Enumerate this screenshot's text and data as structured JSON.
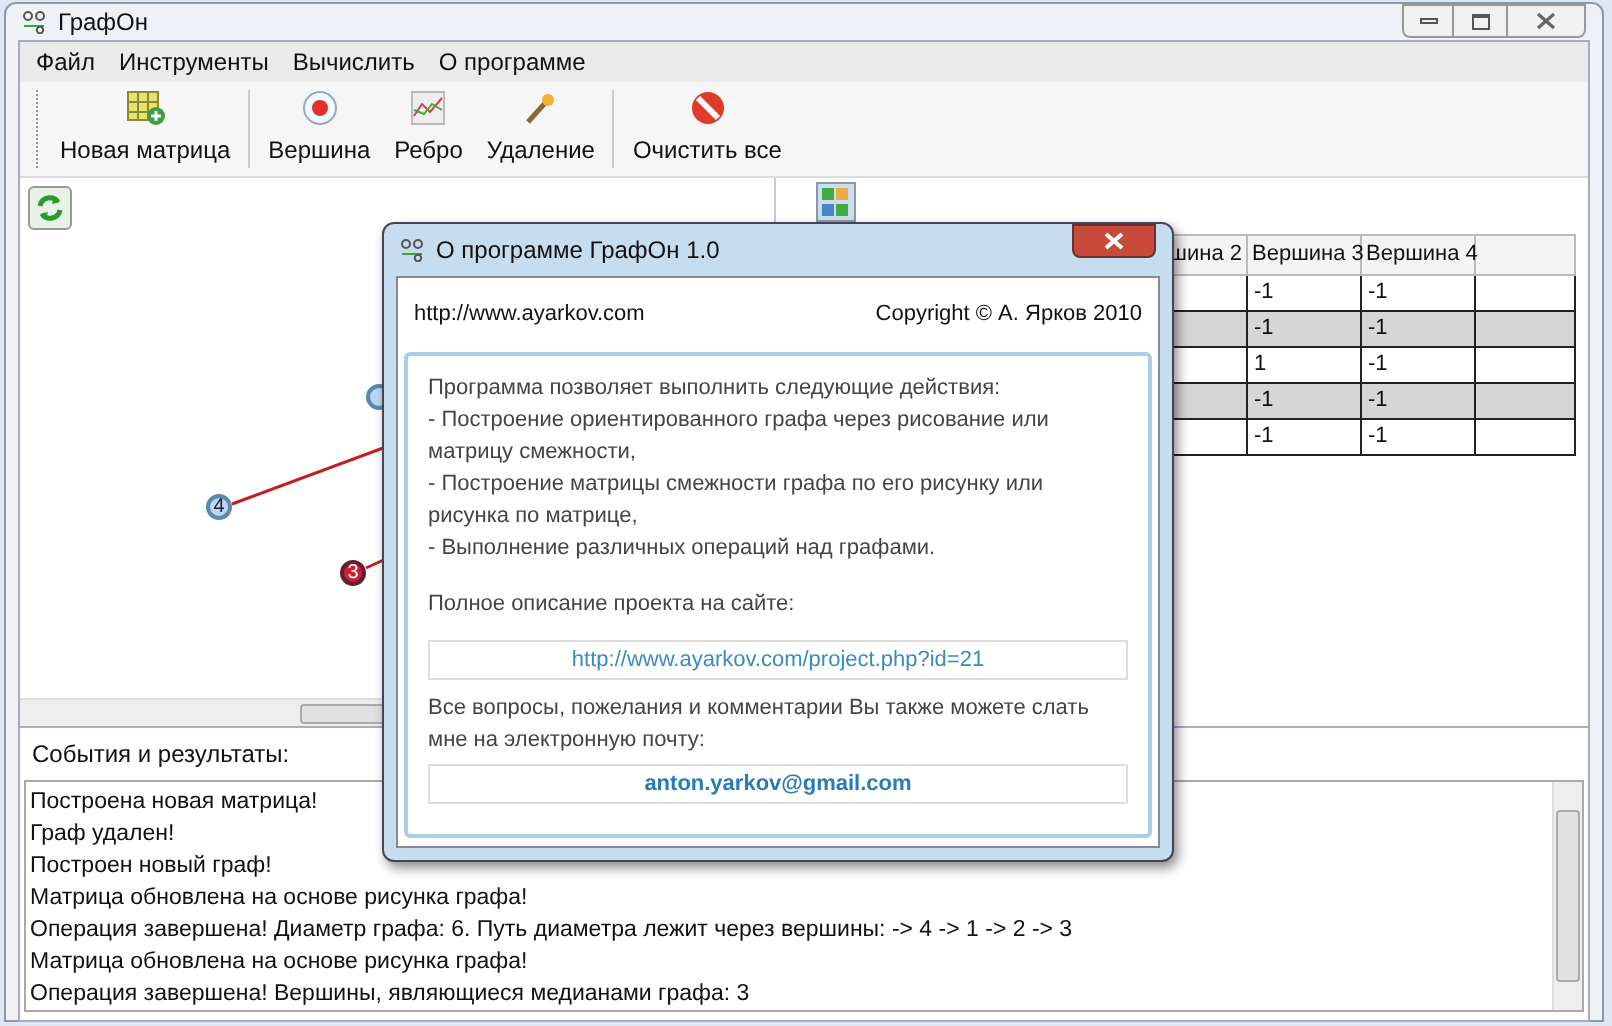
{
  "window": {
    "title": "ГрафОн"
  },
  "menu": [
    "Файл",
    "Инструменты",
    "Вычислить",
    "О программе"
  ],
  "toolbar": [
    {
      "kind": "matrix",
      "label": "Новая матрица"
    },
    {
      "kind": "vertex",
      "label": "Вершина"
    },
    {
      "kind": "edge",
      "label": "Ребро"
    },
    {
      "kind": "delete",
      "label": "Удаление"
    },
    {
      "kind": "clear",
      "label": "Очистить все"
    }
  ],
  "canvas": {
    "nodes": [
      {
        "selected": false
      },
      {
        "label": "4",
        "selected": false
      },
      {
        "label": "3",
        "selected": true
      }
    ]
  },
  "matrix": {
    "columns": [
      "шина 2",
      "Вершина 3",
      "Вершина 4"
    ],
    "rows": [
      [
        "",
        "-1",
        "-1"
      ],
      [
        "",
        "-1",
        "-1"
      ],
      [
        "",
        "1",
        "-1"
      ],
      [
        "",
        "-1",
        "-1"
      ],
      [
        "",
        "-1",
        "-1"
      ]
    ]
  },
  "events": {
    "label": "События и результаты:",
    "lines": [
      "Построена новая матрица!",
      "Граф удален!",
      "Построен новый граф!",
      "Матрица обновлена на основе рисунка графа!",
      "Операция завершена! Диаметр графа: 6. Путь диаметра лежит через вершины: -> 4 -> 1 -> 2 -> 3",
      "Матрица обновлена на основе рисунка графа!",
      "Операция завершена! Вершины, являющиеся медианами графа: 3"
    ]
  },
  "dialog": {
    "title": "О программе ГрафОн 1.0",
    "site": "http://www.ayarkov.com",
    "copyright": "Copyright © А. Ярков 2010",
    "paragraphs": [
      "Программа позволяет выполнить следующие действия:",
      "- Построение ориентированного графа через рисование или матрицу смежности,",
      "- Построение матрицы смежности графа по его рисунку или рисунка по матрице,",
      "- Выполнение различных операций над графами."
    ],
    "site_label": "Полное описание проекта на сайте:",
    "project_link": "http://www.ayarkov.com/project.php?id=21",
    "mail_label": "Все вопросы, пожелания и комментарии Вы также можете слать мне на электронную почту:",
    "email": "anton.yarkov@gmail.com"
  }
}
